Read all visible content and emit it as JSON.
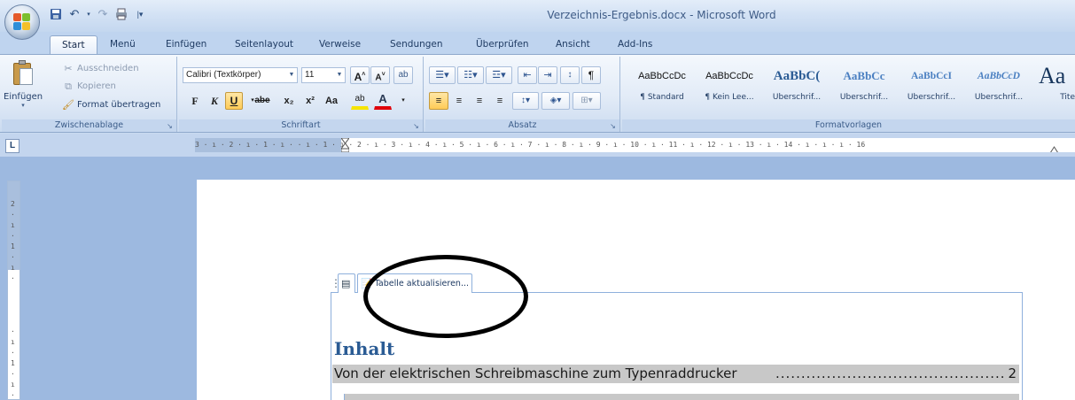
{
  "window": {
    "title": "Verzeichnis-Ergebnis.docx - Microsoft Word"
  },
  "quick_access": [
    "save-icon",
    "undo-icon",
    "redo-icon",
    "print-icon",
    "customize-icon"
  ],
  "tabs": [
    {
      "label": "Start",
      "active": true
    },
    {
      "label": "Menü"
    },
    {
      "label": "Einfügen"
    },
    {
      "label": "Seitenlayout"
    },
    {
      "label": "Verweise"
    },
    {
      "label": "Sendungen"
    },
    {
      "label": "Überprüfen"
    },
    {
      "label": "Ansicht"
    },
    {
      "label": "Add-Ins"
    }
  ],
  "clipboard": {
    "paste_label": "Einfügen",
    "cut_label": "Ausschneiden",
    "copy_label": "Kopieren",
    "format_painter_label": "Format übertragen",
    "group_label": "Zwischenablage"
  },
  "font": {
    "family": "Calibri (Textkörper)",
    "size": "11",
    "bold": "F",
    "italic": "K",
    "underline": "U",
    "strike": "abe",
    "subscript": "x₂",
    "superscript": "x²",
    "change_case": "Aa",
    "highlight": "ab",
    "font_color": "A",
    "grow": "A",
    "shrink": "A",
    "group_label": "Schriftart"
  },
  "paragraph": {
    "group_label": "Absatz"
  },
  "styles": {
    "group_label": "Formatvorlagen",
    "items": [
      {
        "sample": "AaBbCcDc",
        "name": "¶ Standard"
      },
      {
        "sample": "AaBbCcDc",
        "name": "¶ Kein Lee..."
      },
      {
        "sample": "AaBbC(",
        "name": "Überschrif..."
      },
      {
        "sample": "AaBbCc",
        "name": "Überschrif..."
      },
      {
        "sample": "AaBbCcI",
        "name": "Überschrif..."
      },
      {
        "sample": "AaBbCcD",
        "name": "Überschrif..."
      },
      {
        "sample": "Aa",
        "name": "Tite"
      }
    ]
  },
  "ruler": {
    "corner_icon": "tab-stop-icon",
    "h_text": "3 · ı · 2 · ı · 1 · ı ·     · ı · 1 · ı · 2 · ı · 3 · ı · 4 · ı · 5 · ı · 6 · ı · 7 · ı · 8 · ı · 9 · ı · 10 · ı · 11 · ı · 12 · ı · 13 · ı · 14 · ı · ı · ı · 16"
  },
  "toc": {
    "update_button": "Tabelle aktualisieren...",
    "heading": "Inhalt",
    "entry_text": "Von der elektrischen Schreibmaschine zum Typenraddrucker",
    "entry_leader": "......................................................................................................................................",
    "entry_page": "2"
  },
  "colors": {
    "accent": "#2a5b94",
    "ribbon": "#dfe9f5",
    "field_shading": "#c8c8c8",
    "annotation": "#000000"
  }
}
